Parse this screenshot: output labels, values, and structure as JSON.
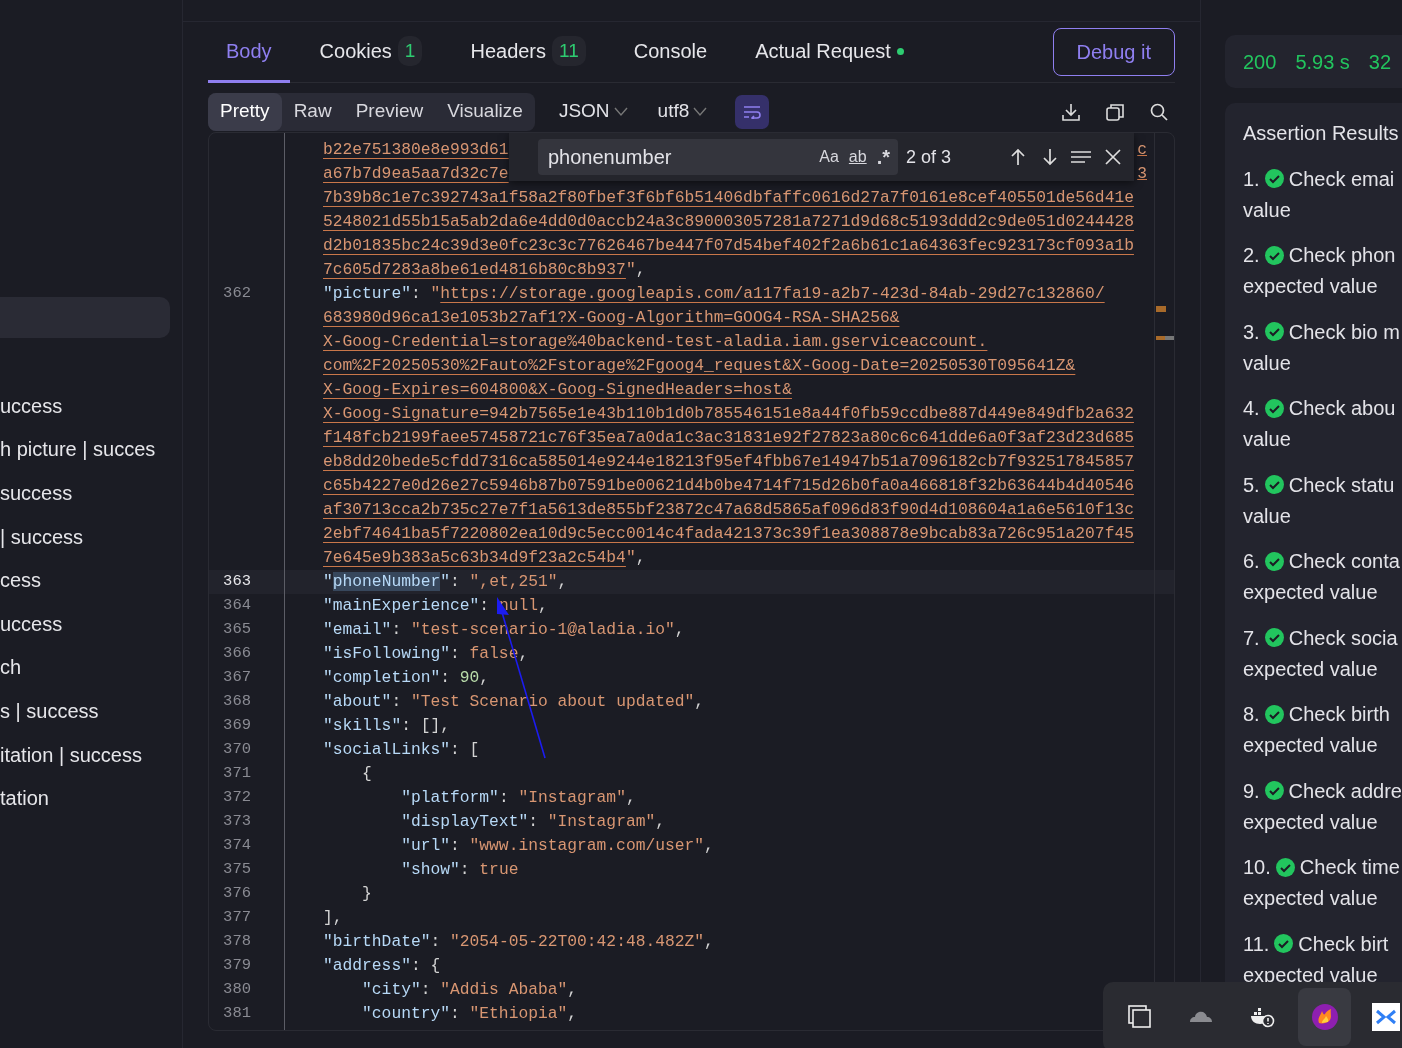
{
  "sidebar": {
    "items": [
      {
        "selected": true
      },
      {
        "label": "uccess",
        "selected": false
      },
      {
        "label": "h picture | succes",
        "selected": false
      },
      {
        "label": "success",
        "selected": false
      },
      {
        "label": "| success",
        "selected": false
      },
      {
        "label": "cess",
        "selected": false
      },
      {
        "label": "uccess",
        "selected": false
      },
      {
        "label": "ch",
        "selected": false
      },
      {
        "label": "s | success",
        "selected": false
      },
      {
        "label": "itation | success",
        "selected": false
      },
      {
        "label": "tation",
        "selected": false
      }
    ]
  },
  "tabs": [
    {
      "label": "Body",
      "selected": true
    },
    {
      "label": "Cookies",
      "count": "1",
      "selected": false
    },
    {
      "label": "Headers",
      "count": "11",
      "selected": false
    },
    {
      "label": "Console",
      "selected": false
    },
    {
      "label": "Actual Request",
      "indicator": true,
      "selected": false
    }
  ],
  "debug_button": "Debug it",
  "views": [
    {
      "label": "Pretty",
      "selected": true
    },
    {
      "label": "Raw",
      "selected": false
    },
    {
      "label": "Preview",
      "selected": false
    },
    {
      "label": "Visualize",
      "selected": false
    }
  ],
  "format": "JSON",
  "encoding": "utf8",
  "word_wrap": {
    "on": true
  },
  "find": {
    "value": "phonenumber",
    "options": [
      {
        "kind": "case",
        "label": "Aa",
        "on": false
      },
      {
        "kind": "word",
        "label": "ab",
        "on": false
      },
      {
        "kind": "regex",
        "label": ".*",
        "on": false
      }
    ],
    "count": "2 of 3"
  },
  "code": [
    {
      "segs": [
        {
          "kind": "link",
          "text": "b22e751380e8e993d61"
        }
      ],
      "tail": "c"
    },
    {
      "segs": [
        {
          "kind": "link",
          "text": "a67b7d9ea5aa7d32c7e"
        }
      ],
      "tail": "3"
    },
    {
      "segs": [
        {
          "kind": "link",
          "text": "7b39b8c1e7c392743a1f58a2f80fbef3f6bf6b51406dbfaffc0616d27a7f0161e8cef405501de56d41e"
        }
      ]
    },
    {
      "segs": [
        {
          "kind": "link",
          "text": "5248021d55b15a5ab2da6e4dd0d0accb24a3c890003057281a7271d9d68c5193ddd2c9de051d0244428"
        }
      ]
    },
    {
      "segs": [
        {
          "kind": "link",
          "text": "d2b01835bc24c39d3e0fc23c3c77626467be447f07d54bef402f2a6b61c1a64363fec923173cf093a1b"
        }
      ]
    },
    {
      "segs": [
        {
          "kind": "link",
          "text": "7c605d7283a8be61ed4816b80c8b937"
        },
        {
          "kind": "str",
          "text": "\""
        },
        {
          "kind": "p",
          "text": ","
        }
      ]
    },
    {
      "num": "362",
      "segs": [
        {
          "kind": "key",
          "text": "\"picture\""
        },
        {
          "kind": "p",
          "text": ": "
        },
        {
          "kind": "str",
          "text": "\""
        },
        {
          "kind": "link",
          "text": "https://storage.googleapis.com/a117fa19-a2b7-423d-84ab-29d27c132860/"
        }
      ]
    },
    {
      "segs": [
        {
          "kind": "link",
          "text": "683980d96ca13e1053b27af1?X-Goog-Algorithm=GOOG4-RSA-SHA256&"
        }
      ]
    },
    {
      "segs": [
        {
          "kind": "link",
          "text": "X-Goog-Credential=storage%40backend-test-aladia.iam.gserviceaccount."
        }
      ]
    },
    {
      "segs": [
        {
          "kind": "link",
          "text": "com%2F20250530%2Fauto%2Fstorage%2Fgoog4_request&X-Goog-Date=20250530T095641Z&"
        }
      ]
    },
    {
      "segs": [
        {
          "kind": "link",
          "text": "X-Goog-Expires=604800&X-Goog-SignedHeaders=host&"
        }
      ]
    },
    {
      "segs": [
        {
          "kind": "link",
          "text": "X-Goog-Signature=942b7565e1e43b110b1d0b785546151e8a44f0fb59ccdbe887d449e849dfb2a632"
        }
      ]
    },
    {
      "segs": [
        {
          "kind": "link",
          "text": "f148fcb2199faee57458721c76f35ea7a0da1c3ac31831e92f27823a80c6c641dde6a0f3af23d23d685"
        }
      ]
    },
    {
      "segs": [
        {
          "kind": "link",
          "text": "eb8dd20bede5cfdd7316ca585014e9244e18213f95ef4fbb67e14947b51a7096182cb7f932517845857"
        }
      ]
    },
    {
      "segs": [
        {
          "kind": "link",
          "text": "c65b4227e0d26e27c5946b87b07591be00621d4b0be4714f715d26b0fa0a466818f32b63644b4d40546"
        }
      ]
    },
    {
      "segs": [
        {
          "kind": "link",
          "text": "af30713cca2b735c27e7f1a5613de855bf23872c47a68d5865af096d83f90d4d108604a1a6e5610f13c"
        }
      ]
    },
    {
      "segs": [
        {
          "kind": "link",
          "text": "2ebf74641ba5f7220802ea10d9c5ecc0014c4fada421373c39f1ea308878e9bcab83a726c951a207f45"
        }
      ]
    },
    {
      "segs": [
        {
          "kind": "link",
          "text": "7e645e9b383a5c63b34d9f23a2c54b4"
        },
        {
          "kind": "str",
          "text": "\""
        },
        {
          "kind": "p",
          "text": ","
        }
      ]
    },
    {
      "num": "363",
      "active": true,
      "segs": [
        {
          "kind": "key",
          "text": "\""
        },
        {
          "kind": "match",
          "text": "phoneNumber"
        },
        {
          "kind": "key",
          "text": "\""
        },
        {
          "kind": "p",
          "text": ": "
        },
        {
          "kind": "str",
          "text": "\",et,251\""
        },
        {
          "kind": "p",
          "text": ","
        }
      ]
    },
    {
      "num": "364",
      "segs": [
        {
          "kind": "key",
          "text": "\"mainExperience\""
        },
        {
          "kind": "p",
          "text": ": "
        },
        {
          "kind": "lit",
          "text": "null"
        },
        {
          "kind": "p",
          "text": ","
        }
      ]
    },
    {
      "num": "365",
      "segs": [
        {
          "kind": "key",
          "text": "\"email\""
        },
        {
          "kind": "p",
          "text": ": "
        },
        {
          "kind": "str",
          "text": "\"test-scenario-1@aladia.io\""
        },
        {
          "kind": "p",
          "text": ","
        }
      ]
    },
    {
      "num": "366",
      "segs": [
        {
          "kind": "key",
          "text": "\"isFollowing\""
        },
        {
          "kind": "p",
          "text": ": "
        },
        {
          "kind": "lit",
          "text": "false"
        },
        {
          "kind": "p",
          "text": ","
        }
      ]
    },
    {
      "num": "367",
      "segs": [
        {
          "kind": "key",
          "text": "\"completion\""
        },
        {
          "kind": "p",
          "text": ": "
        },
        {
          "kind": "num",
          "text": "90"
        },
        {
          "kind": "p",
          "text": ","
        }
      ]
    },
    {
      "num": "368",
      "segs": [
        {
          "kind": "key",
          "text": "\"about\""
        },
        {
          "kind": "p",
          "text": ": "
        },
        {
          "kind": "str",
          "text": "\"Test Scenario about updated\""
        },
        {
          "kind": "p",
          "text": ","
        }
      ]
    },
    {
      "num": "369",
      "segs": [
        {
          "kind": "key",
          "text": "\"skills\""
        },
        {
          "kind": "p",
          "text": ": [],"
        }
      ]
    },
    {
      "num": "370",
      "segs": [
        {
          "kind": "key",
          "text": "\"socialLinks\""
        },
        {
          "kind": "p",
          "text": ": ["
        }
      ]
    },
    {
      "num": "371",
      "segs": [
        {
          "kind": "p",
          "text": "    {"
        }
      ]
    },
    {
      "num": "372",
      "segs": [
        {
          "kind": "key",
          "text": "        \"platform\""
        },
        {
          "kind": "p",
          "text": ": "
        },
        {
          "kind": "str",
          "text": "\"Instagram\""
        },
        {
          "kind": "p",
          "text": ","
        }
      ]
    },
    {
      "num": "373",
      "segs": [
        {
          "kind": "key",
          "text": "        \"displayText\""
        },
        {
          "kind": "p",
          "text": ": "
        },
        {
          "kind": "str",
          "text": "\"Instagram\""
        },
        {
          "kind": "p",
          "text": ","
        }
      ]
    },
    {
      "num": "374",
      "segs": [
        {
          "kind": "key",
          "text": "        \"url\""
        },
        {
          "kind": "p",
          "text": ": "
        },
        {
          "kind": "str",
          "text": "\"www.instagram.com/user\""
        },
        {
          "kind": "p",
          "text": ","
        }
      ]
    },
    {
      "num": "375",
      "segs": [
        {
          "kind": "key",
          "text": "        \"show\""
        },
        {
          "kind": "p",
          "text": ": "
        },
        {
          "kind": "lit",
          "text": "true"
        }
      ]
    },
    {
      "num": "376",
      "segs": [
        {
          "kind": "p",
          "text": "    }"
        }
      ]
    },
    {
      "num": "377",
      "segs": [
        {
          "kind": "p",
          "text": "],"
        }
      ]
    },
    {
      "num": "378",
      "segs": [
        {
          "kind": "key",
          "text": "\"birthDate\""
        },
        {
          "kind": "p",
          "text": ": "
        },
        {
          "kind": "str",
          "text": "\"2054-05-22T00:42:48.482Z\""
        },
        {
          "kind": "p",
          "text": ","
        }
      ]
    },
    {
      "num": "379",
      "segs": [
        {
          "kind": "key",
          "text": "\"address\""
        },
        {
          "kind": "p",
          "text": ": {"
        }
      ]
    },
    {
      "num": "380",
      "segs": [
        {
          "kind": "key",
          "text": "    \"city\""
        },
        {
          "kind": "p",
          "text": ": "
        },
        {
          "kind": "str",
          "text": "\"Addis Ababa\""
        },
        {
          "kind": "p",
          "text": ","
        }
      ]
    },
    {
      "num": "381",
      "segs": [
        {
          "kind": "key",
          "text": "    \"country\""
        },
        {
          "kind": "p",
          "text": ": "
        },
        {
          "kind": "str",
          "text": "\"Ethiopia\""
        },
        {
          "kind": "p",
          "text": ","
        }
      ]
    }
  ],
  "status": [
    "200",
    "5.93 s",
    "32"
  ],
  "assertions": {
    "title": "Assertion Results",
    "items": [
      {
        "index": "1.",
        "passed": true,
        "line1": "Check emai",
        "line2": "value"
      },
      {
        "index": "2.",
        "passed": true,
        "line1": "Check phon",
        "line2": "expected value"
      },
      {
        "index": "3.",
        "passed": true,
        "line1": "Check bio m",
        "line2": "value"
      },
      {
        "index": "4.",
        "passed": true,
        "line1": "Check abou",
        "line2": "value"
      },
      {
        "index": "5.",
        "passed": true,
        "line1": "Check statu",
        "line2": "value"
      },
      {
        "index": "6.",
        "passed": true,
        "line1": "Check conta",
        "line2": "expected value"
      },
      {
        "index": "7.",
        "passed": true,
        "line1": "Check socia",
        "line2": "expected value"
      },
      {
        "index": "8.",
        "passed": true,
        "line1": "Check birth",
        "line2": "expected value"
      },
      {
        "index": "9.",
        "passed": true,
        "line1": "Check addre",
        "line2": "expected value"
      },
      {
        "index": "10.",
        "passed": true,
        "line1": "Check time",
        "line2": "expected value"
      },
      {
        "index": "11.",
        "passed": true,
        "line1": "Check birt",
        "line2": "expected value"
      }
    ]
  },
  "taskbar": [
    {
      "kind": "windows",
      "selected": false
    },
    {
      "kind": "cloud",
      "selected": false
    },
    {
      "kind": "whale",
      "selected": false
    },
    {
      "kind": "flame",
      "selected": true
    },
    {
      "kind": "app",
      "selected": false
    }
  ]
}
